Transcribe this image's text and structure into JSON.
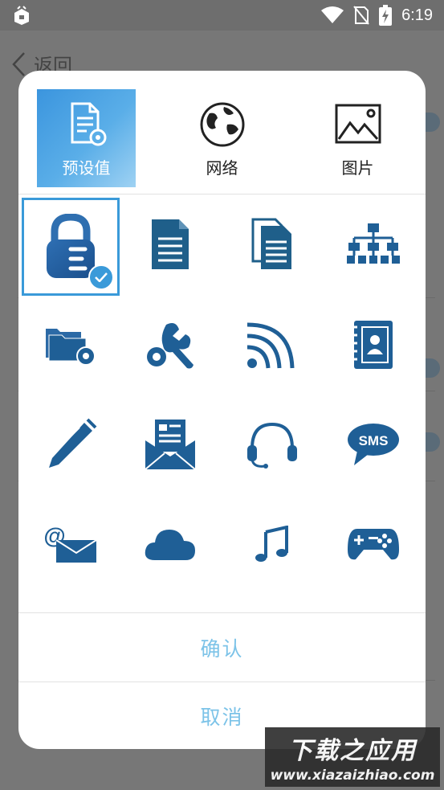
{
  "status_bar": {
    "time": "6:19",
    "icons": [
      "app-notification-icon",
      "wifi-icon",
      "no-sim-icon",
      "battery-charging-icon"
    ]
  },
  "background": {
    "back_label": "返回"
  },
  "dialog": {
    "tabs": [
      {
        "label": "预设值",
        "icon": "document-gear-icon",
        "active": true
      },
      {
        "label": "网络",
        "icon": "globe-icon",
        "active": false
      },
      {
        "label": "图片",
        "icon": "image-icon",
        "active": false
      }
    ],
    "icons": [
      {
        "name": "lock-icon",
        "selected": true
      },
      {
        "name": "document-icon",
        "selected": false
      },
      {
        "name": "documents-icon",
        "selected": false
      },
      {
        "name": "sitemap-icon",
        "selected": false
      },
      {
        "name": "folder-settings-icon",
        "selected": false
      },
      {
        "name": "wrench-gear-icon",
        "selected": false
      },
      {
        "name": "rss-icon",
        "selected": false
      },
      {
        "name": "contacts-book-icon",
        "selected": false
      },
      {
        "name": "pen-icon",
        "selected": false
      },
      {
        "name": "envelope-letter-icon",
        "selected": false
      },
      {
        "name": "headset-icon",
        "selected": false
      },
      {
        "name": "sms-bubble-icon",
        "selected": false,
        "text": "SMS"
      },
      {
        "name": "email-at-icon",
        "selected": false,
        "text": "@"
      },
      {
        "name": "cloud-icon",
        "selected": false
      },
      {
        "name": "music-note-icon",
        "selected": false
      },
      {
        "name": "gamepad-icon",
        "selected": false
      }
    ],
    "confirm_label": "确认",
    "cancel_label": "取消"
  },
  "watermark": {
    "main": "下载之应用",
    "sub": "www.xiazaizhiao.com"
  },
  "colors": {
    "icon_blue": "#1f5f96",
    "accent": "#3a9ad9",
    "action_text": "#7cc3e8"
  }
}
